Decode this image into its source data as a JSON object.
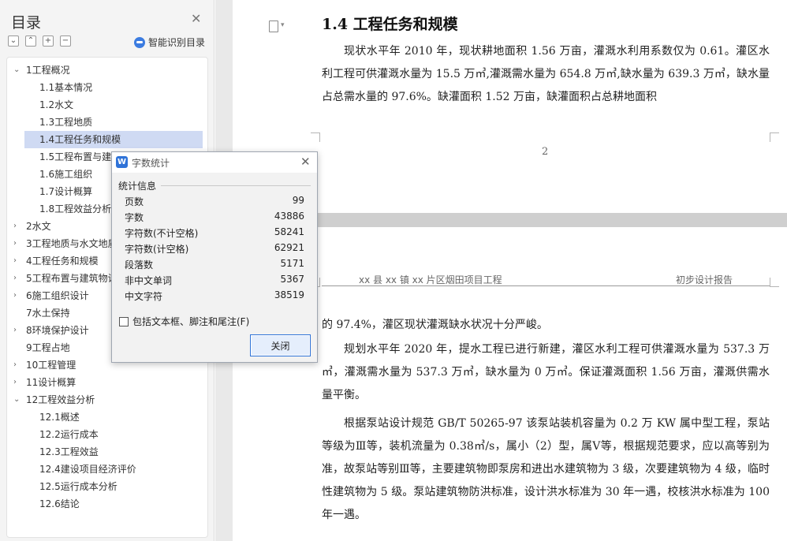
{
  "sidebar": {
    "title": "目录",
    "smart_label": "智能识别目录",
    "items": [
      {
        "label": "1工程概况",
        "level": 1,
        "expanded": true
      },
      {
        "label": "1.1基本情况",
        "level": 2
      },
      {
        "label": "1.2水文",
        "level": 2
      },
      {
        "label": "1.3工程地质",
        "level": 2
      },
      {
        "label": "1.4工程任务和规模",
        "level": 2,
        "selected": true
      },
      {
        "label": "1.5工程布置与建筑",
        "level": 2
      },
      {
        "label": "1.6施工组织",
        "level": 2
      },
      {
        "label": "1.7设计概算",
        "level": 2
      },
      {
        "label": "1.8工程效益分析",
        "level": 2
      },
      {
        "label": "2水文",
        "level": 1,
        "expanded": false
      },
      {
        "label": "3工程地质与水文地质",
        "level": 1,
        "expanded": false
      },
      {
        "label": "4工程任务和规模",
        "level": 1,
        "expanded": false
      },
      {
        "label": "5工程布置与建筑物设计",
        "level": 1,
        "expanded": false
      },
      {
        "label": "6施工组织设计",
        "level": 1,
        "expanded": false
      },
      {
        "label": "7水土保持",
        "level": 1
      },
      {
        "label": "8环境保护设计",
        "level": 1,
        "expanded": false
      },
      {
        "label": "9工程占地",
        "level": 1
      },
      {
        "label": "10工程管理",
        "level": 1,
        "expanded": false
      },
      {
        "label": "11设计概算",
        "level": 1,
        "expanded": false
      },
      {
        "label": "12工程效益分析",
        "level": 1,
        "expanded": true
      },
      {
        "label": "12.1概述",
        "level": 2
      },
      {
        "label": "12.2运行成本",
        "level": 2
      },
      {
        "label": "12.3工程效益",
        "level": 2
      },
      {
        "label": "12.4建设项目经济评价",
        "level": 2
      },
      {
        "label": "12.5运行成本分析",
        "level": 2
      },
      {
        "label": "12.6结论",
        "level": 2
      }
    ]
  },
  "doc": {
    "heading": "1.4 工程任务和规模",
    "p1": "现状水平年 2010 年，现状耕地面积 1.56 万亩，灌溉水利用系数仅为 0.61。灌区水利工程可供灌溉水量为 15.5 万㎥,灌溉需水量为 654.8 万㎥,缺水量为 639.3 万㎥，缺水量占总需水量的 97.6%。缺灌面积 1.52 万亩，缺灌面积占总耕地面积",
    "page_number": "2",
    "header_left": "xx 县 xx 镇 xx 片区烟田项目工程",
    "header_right": "初步设计报告",
    "p2": "的 97.4%，灌区现状灌溉缺水状况十分严峻。",
    "p3": "规划水平年 2020 年，提水工程已进行新建，灌区水利工程可供灌溉水量为 537.3 万㎥，灌溉需水量为 537.3 万㎥，缺水量为 0 万㎥。保证灌溉面积 1.56 万亩，灌溉供需水量平衡。",
    "p4": "根据泵站设计规范 GB/T 50265-97 该泵站装机容量为 0.2 万 KW 属中型工程，泵站等级为Ⅲ等，装机流量为 0.38㎥/s，属小（2）型，属Ⅴ等，根据规范要求，应以高等别为准，故泵站等别Ⅲ等，主要建筑物即泵房和进出水建筑物为 3 级，次要建筑物为 4 级，临时性建筑物为 5 级。泵站建筑物防洪标准，设计洪水标准为 30 年一遇，校核洪水标准为 100 年一遇。"
  },
  "dialog": {
    "title": "字数统计",
    "section": "统计信息",
    "stats": [
      {
        "key": "页数",
        "value": "99"
      },
      {
        "key": "字数",
        "value": "43886"
      },
      {
        "key": "字符数(不计空格)",
        "value": "58241"
      },
      {
        "key": "字符数(计空格)",
        "value": "62921"
      },
      {
        "key": "段落数",
        "value": "5171"
      },
      {
        "key": "非中文单词",
        "value": "5367"
      },
      {
        "key": "中文字符",
        "value": "38519"
      }
    ],
    "checkbox_label": "包括文本框、脚注和尾注(F)",
    "checkbox_checked": false,
    "close_label": "关闭",
    "logo": "W"
  },
  "colors": {
    "accent": "#2f73d8",
    "selection": "#cfdaf3"
  }
}
